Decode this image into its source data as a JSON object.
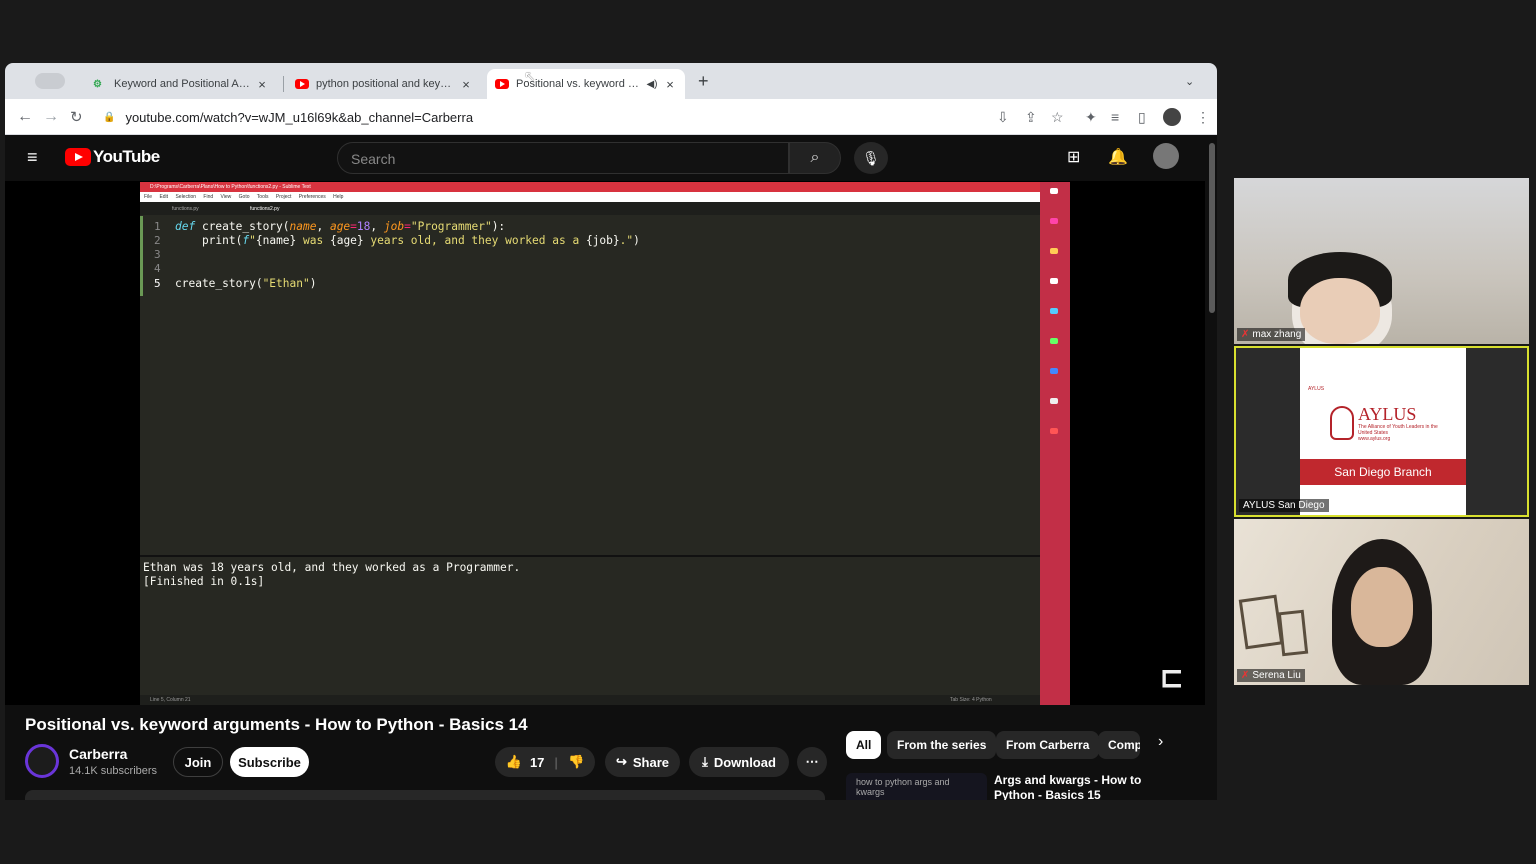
{
  "browser": {
    "tabs": [
      {
        "title": "Keyword and Positional Argum",
        "favicon": "gear-icon"
      },
      {
        "title": "python positional and keywor",
        "favicon": "youtube-icon"
      },
      {
        "title": "Positional vs. keyword arg",
        "favicon": "youtube-icon",
        "active": true
      }
    ],
    "url": "youtube.com/watch?v=wJM_u16l69k&ab_channel=Carberra"
  },
  "youtube": {
    "logo": "YouTube",
    "search_placeholder": "Search"
  },
  "editor": {
    "title": "D:\\Programs\\Carberra\\Plans\\How to Python\\functions2.py - Sublime Text",
    "menu": "File Edit Selection Find View Goto Tools Project Preferences Help",
    "tabs": [
      "functions.py",
      "functions2.py"
    ],
    "line_numbers": [
      "1",
      "2",
      "3",
      "4",
      "5"
    ],
    "output": [
      "Ethan was 18 years old, and they worked as a Programmer.",
      "[Finished in 0.1s]"
    ],
    "status_left": "Line 5, Column 21",
    "status_right": "Tab Size: 4      Python"
  },
  "video": {
    "title": "Positional vs. keyword arguments - How to Python - Basics 14",
    "channel": "Carberra",
    "subscribers": "14.1K subscribers",
    "join": "Join",
    "subscribe": "Subscribe",
    "likes": "17",
    "share": "Share",
    "download": "Download"
  },
  "chips": [
    "All",
    "From the series",
    "From Carberra",
    "Comp"
  ],
  "related": {
    "title": "Args and kwargs - How to Python - Basics 15",
    "thumb_text": "how to python args and kwargs"
  },
  "call": {
    "participants": [
      "max zhang",
      "AYLUS San Diego",
      "Serena Liu"
    ],
    "slide": {
      "brand_small": "AYLUS",
      "brand": "AYLUS",
      "tagline": "The Alliance of Youth Leaders in the United States",
      "site": "www.aylus.org",
      "branch": "San Diego Branch"
    }
  }
}
